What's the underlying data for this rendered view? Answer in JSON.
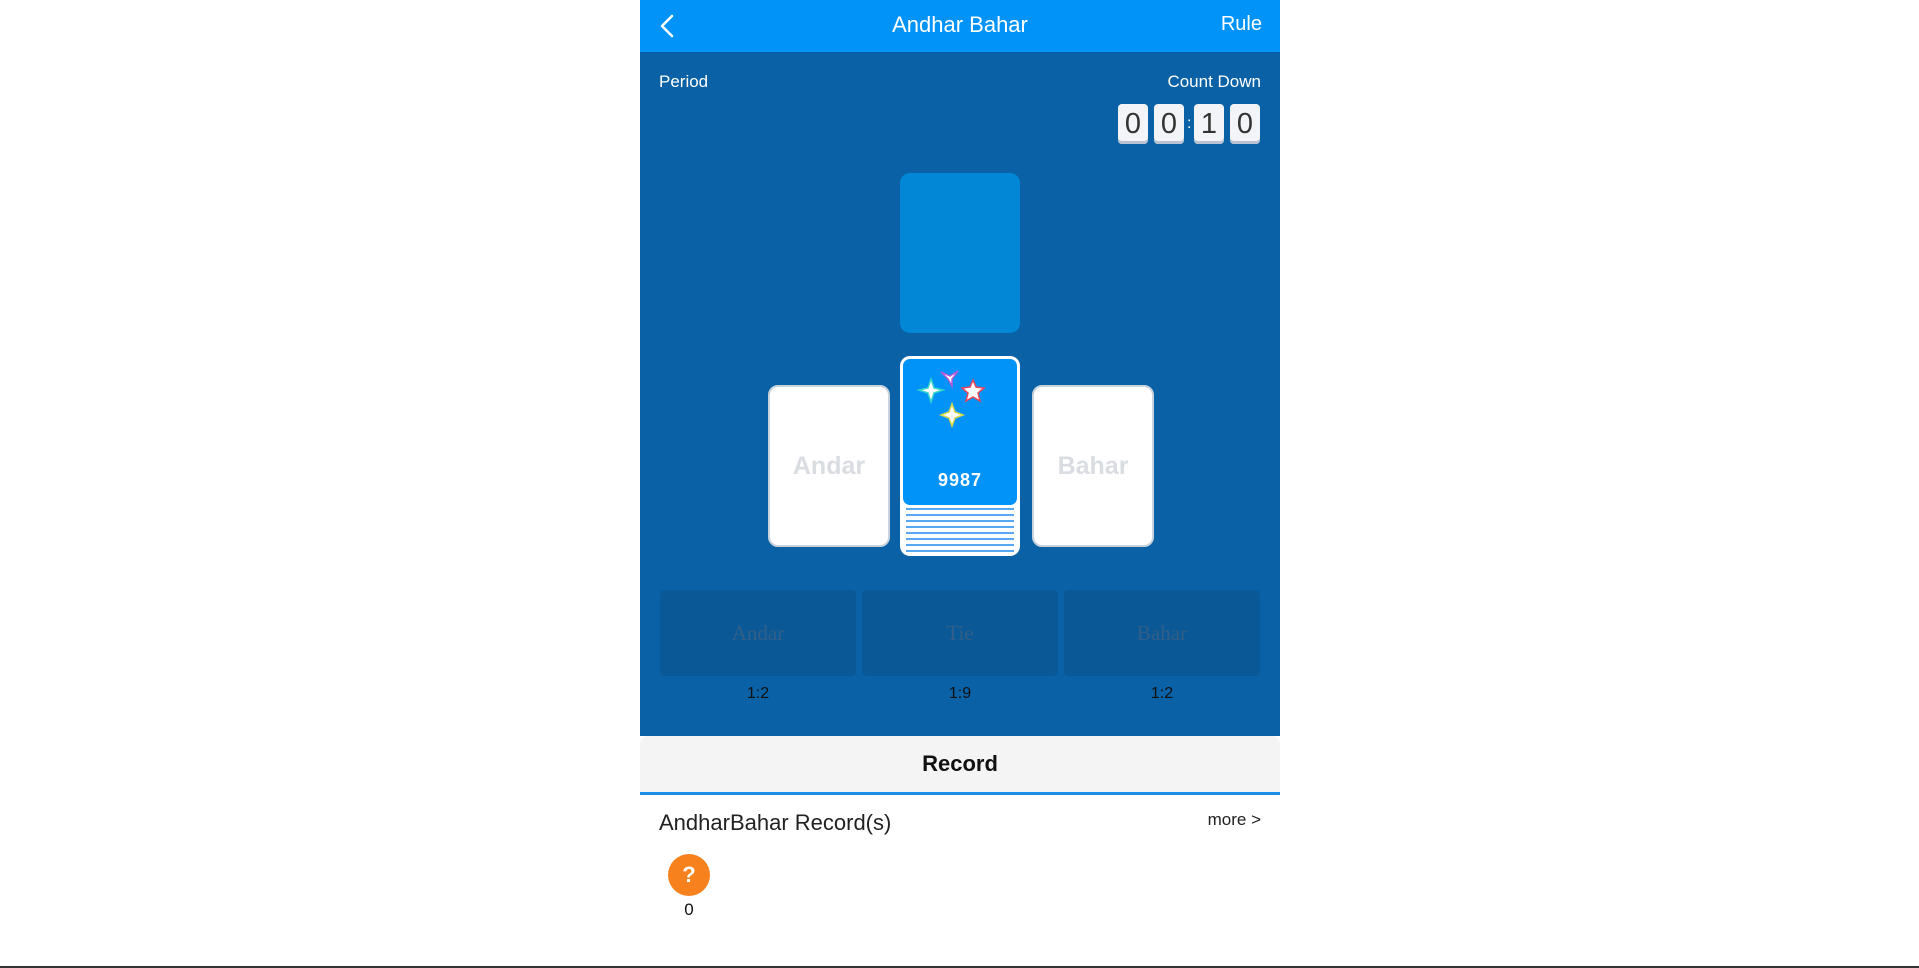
{
  "header": {
    "title": "Andhar Bahar",
    "rule_label": "Rule",
    "back_icon": "chevron-left-icon"
  },
  "game": {
    "period_label": "Period",
    "countdown_label": "Count Down",
    "countdown_digits": [
      "0",
      "0",
      "1",
      "0"
    ],
    "countdown_separator": ":",
    "andar_card_label": "Andar",
    "bahar_card_label": "Bahar",
    "deck_count": "9987",
    "deck_icon": "sparkle-stars-icon"
  },
  "bets": [
    {
      "label": "Andar",
      "odds": "1:2"
    },
    {
      "label": "Tie",
      "odds": "1:9"
    },
    {
      "label": "Bahar",
      "odds": "1:2"
    }
  ],
  "record": {
    "tab_label": "Record",
    "section_title": "AndharBahar Record(s)",
    "more_label": "more >",
    "items": [
      {
        "symbol": "?",
        "number": "0"
      }
    ]
  },
  "colors": {
    "header_bg": "#0293f9",
    "game_bg": "#0a61a5",
    "record_badge": "#f7821d",
    "tab_underline": "#1b8fe8"
  }
}
